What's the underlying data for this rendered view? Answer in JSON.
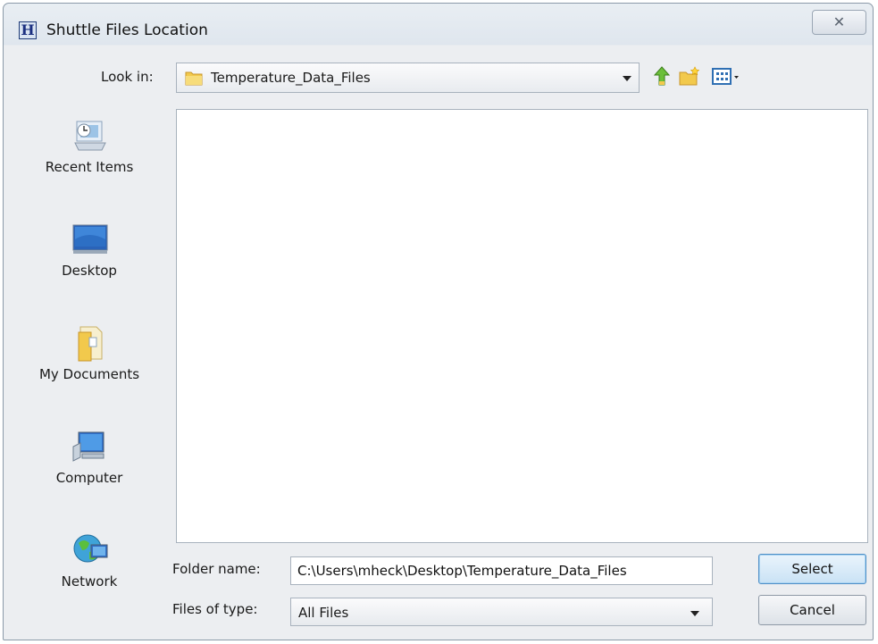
{
  "window": {
    "title": "Shuttle Files Location",
    "app_icon_letter": "H",
    "close_glyph": "✕"
  },
  "look_in": {
    "label": "Look in:",
    "value": "Temperature_Data_Files"
  },
  "toolbar": {
    "icons": [
      "up-one-level-icon",
      "new-folder-icon",
      "view-menu-icon"
    ]
  },
  "places": [
    {
      "label": "Recent Items",
      "icon": "recent-items-icon"
    },
    {
      "label": "Desktop",
      "icon": "desktop-icon"
    },
    {
      "label": "My Documents",
      "icon": "my-documents-icon"
    },
    {
      "label": "Computer",
      "icon": "computer-icon"
    },
    {
      "label": "Network",
      "icon": "network-icon"
    }
  ],
  "folder_name": {
    "label": "Folder name:",
    "value": "C:\\Users\\mheck\\Desktop\\Temperature_Data_Files"
  },
  "files_of_type": {
    "label": "Files of type:",
    "value": "All Files"
  },
  "buttons": {
    "select": "Select",
    "cancel": "Cancel"
  },
  "colors": {
    "default_button_border": "#4f8fc7",
    "folder_yellow": "#f2c94c"
  }
}
